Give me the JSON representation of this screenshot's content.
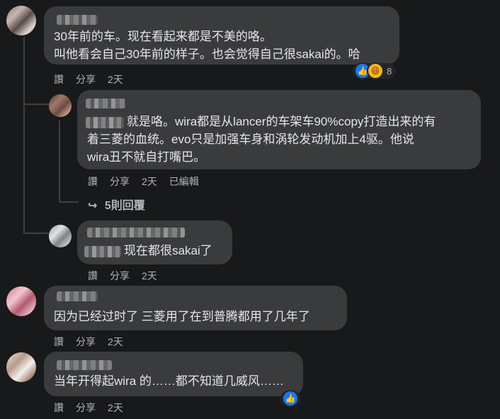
{
  "comments": [
    {
      "lines": [
        "30年前的车。现在看起来都是不美的咯。",
        "叫他看会自己30年前的样子。也会觉得自己很sakai的。哈"
      ],
      "actions": {
        "like": "讚",
        "share": "分享",
        "time": "2天"
      },
      "reactions": {
        "count": "8",
        "icons": [
          "like-icon",
          "haha-icon"
        ]
      }
    },
    {
      "lines": [
        "就是咯。wira都是从lancer的车架车90%copy打造出来的有",
        "着三菱的血统。evo只是加强车身和涡轮发动机加上4驱。他说",
        "wira丑不就自打嘴巴。"
      ],
      "actions": {
        "like": "讚",
        "share": "分享",
        "time": "2天",
        "edited": "已編輯"
      },
      "replies_label": "5則回覆"
    },
    {
      "lines": [
        "现在都很sakai了"
      ],
      "actions": {
        "like": "讚",
        "share": "分享",
        "time": "2天"
      }
    },
    {
      "lines": [
        "因为已经过时了 三菱用了在到普腾都用了几年了"
      ],
      "actions": {
        "like": "讚",
        "share": "分享",
        "time": "2天"
      }
    },
    {
      "lines": [
        "当年开得起wira 的……都不知道几威风……"
      ],
      "actions": {
        "like": "讚",
        "share": "分享",
        "time": "2天"
      },
      "reactions": {
        "icons": [
          "like-icon"
        ]
      }
    }
  ],
  "icons": {
    "reply_arrow": "reply-arrow-icon"
  },
  "colors": {
    "background": "#18191a",
    "bubble": "#3a3b3c",
    "secondary_text": "#b0b3b8",
    "like_blue": "#1877f2"
  }
}
